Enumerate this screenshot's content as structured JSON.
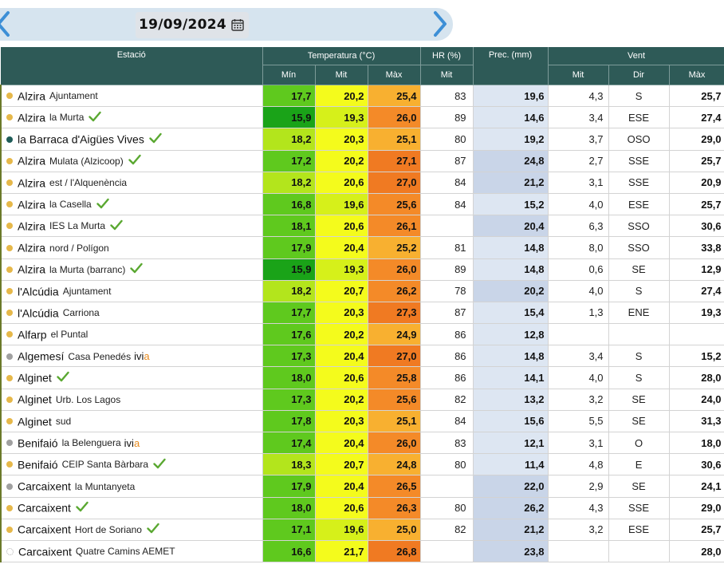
{
  "date": "19/09/2024",
  "headers": {
    "station": "Estació",
    "temperature": "Temperatura (°C)",
    "hr": "HR (%)",
    "prec": "Prec. (mm)",
    "wind": "Vent",
    "t_min": "Mín",
    "t_mit": "Mit",
    "t_max": "Màx",
    "hr_mit": "Mit",
    "w_mit": "Mit",
    "w_dir": "Dir",
    "w_max": "Màx"
  },
  "colors": {
    "header_bg": "#2e5a57",
    "min_light": "#5fc91e",
    "min_dark": "#1aa318",
    "min_yellowgreen": "#b3e51c",
    "mit_yellow": "#f4fb1c",
    "mit_lime": "#d6f01a",
    "max_orange_light": "#f8b030",
    "max_orange": "#f48a28",
    "max_orange_dark": "#f07a22",
    "prec_light": "#dde6f2",
    "prec_mid": "#c9d5e8",
    "dot_yellow": "#e6b84a",
    "dot_gray": "#a0a0a0",
    "dot_teal": "#1f5c58"
  },
  "rows": [
    {
      "name": "Alzira",
      "sub": "Ajuntament",
      "dot": "yellow",
      "check": false,
      "ivia": false,
      "min": "17,7",
      "mit": "20,2",
      "max": "25,4",
      "hr": "83",
      "prec": "19,6",
      "wmit": "4,3",
      "wdir": "S",
      "wmax": "25,7"
    },
    {
      "name": "Alzira",
      "sub": "la Murta",
      "dot": "yellow",
      "check": true,
      "ivia": false,
      "min": "15,9",
      "mit": "19,3",
      "max": "26,0",
      "hr": "89",
      "prec": "14,6",
      "wmit": "3,4",
      "wdir": "ESE",
      "wmax": "27,4"
    },
    {
      "name": "la Barraca d'Aigües Vives",
      "sub": "",
      "dot": "teal",
      "check": true,
      "ivia": false,
      "min": "18,2",
      "mit": "20,3",
      "max": "25,1",
      "hr": "80",
      "prec": "19,2",
      "wmit": "3,7",
      "wdir": "OSO",
      "wmax": "29,0"
    },
    {
      "name": "Alzira",
      "sub": "Mulata (Alzicoop)",
      "dot": "yellow",
      "check": true,
      "ivia": false,
      "min": "17,2",
      "mit": "20,2",
      "max": "27,1",
      "hr": "87",
      "prec": "24,8",
      "wmit": "2,7",
      "wdir": "SSE",
      "wmax": "25,7"
    },
    {
      "name": "Alzira",
      "sub": "est / l'Alquenència",
      "dot": "yellow",
      "check": false,
      "ivia": false,
      "min": "18,2",
      "mit": "20,6",
      "max": "27,0",
      "hr": "84",
      "prec": "21,2",
      "wmit": "3,1",
      "wdir": "SSE",
      "wmax": "20,9"
    },
    {
      "name": "Alzira",
      "sub": "la Casella",
      "dot": "yellow",
      "check": true,
      "ivia": false,
      "min": "16,8",
      "mit": "19,6",
      "max": "25,6",
      "hr": "84",
      "prec": "15,2",
      "wmit": "4,0",
      "wdir": "ESE",
      "wmax": "25,7"
    },
    {
      "name": "Alzira",
      "sub": "IES La Murta",
      "dot": "yellow",
      "check": true,
      "ivia": false,
      "min": "18,1",
      "mit": "20,6",
      "max": "26,1",
      "hr": "",
      "prec": "20,4",
      "wmit": "6,3",
      "wdir": "SSO",
      "wmax": "30,6"
    },
    {
      "name": "Alzira",
      "sub": "nord / Polígon",
      "dot": "yellow",
      "check": false,
      "ivia": false,
      "min": "17,9",
      "mit": "20,4",
      "max": "25,2",
      "hr": "81",
      "prec": "14,8",
      "wmit": "8,0",
      "wdir": "SSO",
      "wmax": "33,8"
    },
    {
      "name": "Alzira",
      "sub": "la Murta (barranc)",
      "dot": "yellow",
      "check": true,
      "ivia": false,
      "min": "15,9",
      "mit": "19,3",
      "max": "26,0",
      "hr": "89",
      "prec": "14,8",
      "wmit": "0,6",
      "wdir": "SE",
      "wmax": "12,9"
    },
    {
      "name": "l'Alcúdia",
      "sub": "Ajuntament",
      "dot": "yellow",
      "check": false,
      "ivia": false,
      "min": "18,2",
      "mit": "20,7",
      "max": "26,2",
      "hr": "78",
      "prec": "20,2",
      "wmit": "4,0",
      "wdir": "S",
      "wmax": "27,4"
    },
    {
      "name": "l'Alcúdia",
      "sub": "Carriona",
      "dot": "yellow",
      "check": false,
      "ivia": false,
      "min": "17,7",
      "mit": "20,3",
      "max": "27,3",
      "hr": "87",
      "prec": "15,4",
      "wmit": "1,3",
      "wdir": "ENE",
      "wmax": "19,3"
    },
    {
      "name": "Alfarp",
      "sub": "el Puntal",
      "dot": "yellow",
      "check": false,
      "ivia": false,
      "min": "17,6",
      "mit": "20,2",
      "max": "24,9",
      "hr": "86",
      "prec": "12,8",
      "wmit": "",
      "wdir": "",
      "wmax": ""
    },
    {
      "name": "Algemesí",
      "sub": "Casa Penedés",
      "dot": "gray",
      "check": false,
      "ivia": true,
      "min": "17,3",
      "mit": "20,4",
      "max": "27,0",
      "hr": "86",
      "prec": "14,8",
      "wmit": "3,4",
      "wdir": "S",
      "wmax": "15,2"
    },
    {
      "name": "Alginet",
      "sub": "",
      "dot": "yellow",
      "check": true,
      "ivia": false,
      "min": "18,0",
      "mit": "20,6",
      "max": "25,8",
      "hr": "86",
      "prec": "14,1",
      "wmit": "4,0",
      "wdir": "S",
      "wmax": "28,0"
    },
    {
      "name": "Alginet",
      "sub": "Urb. Los Lagos",
      "dot": "yellow",
      "check": false,
      "ivia": false,
      "min": "17,3",
      "mit": "20,2",
      "max": "25,6",
      "hr": "82",
      "prec": "13,2",
      "wmit": "3,2",
      "wdir": "SE",
      "wmax": "24,0"
    },
    {
      "name": "Alginet",
      "sub": "sud",
      "dot": "yellow",
      "check": false,
      "ivia": false,
      "min": "17,8",
      "mit": "20,3",
      "max": "25,1",
      "hr": "84",
      "prec": "15,6",
      "wmit": "5,5",
      "wdir": "SE",
      "wmax": "31,3"
    },
    {
      "name": "Benifaió",
      "sub": "la Belenguera",
      "dot": "gray",
      "check": false,
      "ivia": true,
      "min": "17,4",
      "mit": "20,4",
      "max": "26,0",
      "hr": "83",
      "prec": "12,1",
      "wmit": "3,1",
      "wdir": "O",
      "wmax": "18,0"
    },
    {
      "name": "Benifaió",
      "sub": "CEIP Santa Bàrbara",
      "dot": "yellow",
      "check": true,
      "ivia": false,
      "min": "18,3",
      "mit": "20,7",
      "max": "24,8",
      "hr": "80",
      "prec": "11,4",
      "wmit": "4,8",
      "wdir": "E",
      "wmax": "30,6"
    },
    {
      "name": "Carcaixent",
      "sub": "la Muntanyeta",
      "dot": "gray",
      "check": false,
      "ivia": false,
      "min": "17,9",
      "mit": "20,4",
      "max": "26,5",
      "hr": "",
      "prec": "22,0",
      "wmit": "2,9",
      "wdir": "SE",
      "wmax": "24,1"
    },
    {
      "name": "Carcaixent",
      "sub": "",
      "dot": "yellow",
      "check": true,
      "ivia": false,
      "min": "18,0",
      "mit": "20,6",
      "max": "26,3",
      "hr": "80",
      "prec": "26,2",
      "wmit": "4,3",
      "wdir": "SSE",
      "wmax": "29,0"
    },
    {
      "name": "Carcaixent",
      "sub": "Hort de Soriano",
      "dot": "yellow",
      "check": true,
      "ivia": false,
      "min": "17,1",
      "mit": "19,6",
      "max": "25,0",
      "hr": "82",
      "prec": "21,2",
      "wmit": "3,2",
      "wdir": "ESE",
      "wmax": "25,7"
    },
    {
      "name": "Carcaixent",
      "sub": "Quatre Camins AEMET",
      "dot": "none",
      "check": false,
      "ivia": false,
      "min": "16,6",
      "mit": "21,7",
      "max": "26,8",
      "hr": "",
      "prec": "23,8",
      "wmit": "",
      "wdir": "",
      "wmax": "28,0"
    }
  ],
  "ivia_label_i": "ivi",
  "ivia_label_a": "a"
}
